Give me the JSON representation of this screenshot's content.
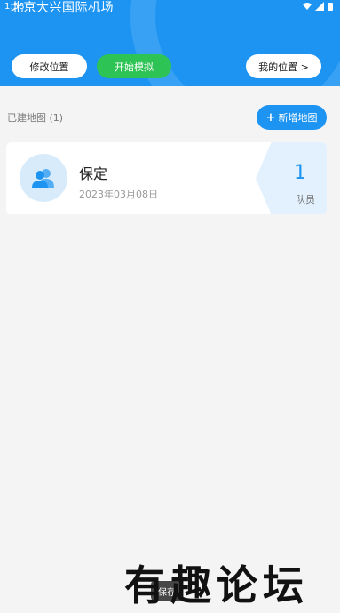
{
  "status": {
    "time": "1:58"
  },
  "header": {
    "location": "北京大兴国际机场",
    "modify_label": "修改位置",
    "start_label": "开始模拟",
    "myloc_label": "我的位置 >"
  },
  "list": {
    "built_label": "已建地图 (1)",
    "add_label": "新增地图",
    "items": [
      {
        "name": "保定",
        "date": "2023年03月08日",
        "members": "1",
        "members_label": "队员"
      }
    ]
  },
  "toast": {
    "text": "保存"
  },
  "watermark": {
    "text": "有趣论坛"
  },
  "colors": {
    "primary": "#1d94f2",
    "green": "#2ec455",
    "background": "#f4f4f4"
  }
}
